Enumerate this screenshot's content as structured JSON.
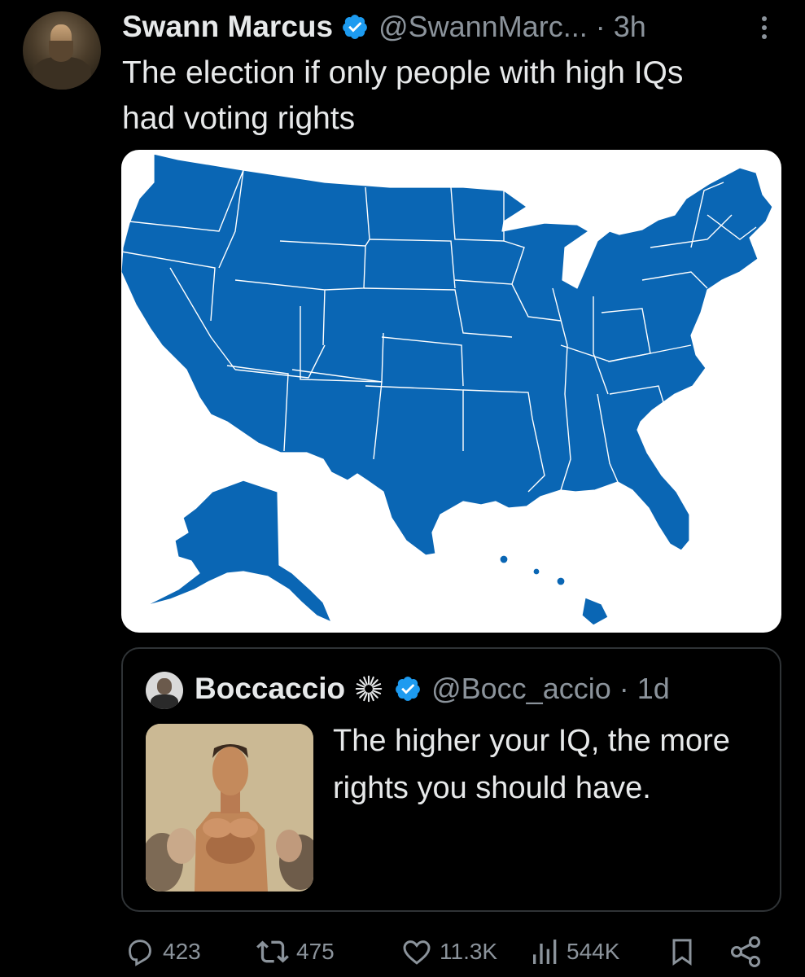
{
  "tweet": {
    "author_name": "Swann Marcus",
    "handle": "@SwannMarc...",
    "time": "· 3h",
    "text_line1": "The election if only people with high IQs",
    "text_line2": "had voting rights",
    "map_fill_color": "#0a66b4"
  },
  "quoted": {
    "author_name": "Boccaccio",
    "handle": "@Bocc_accio",
    "time": "· 1d",
    "text": "The higher your IQ, the more rights you should have."
  },
  "actions": {
    "replies": "423",
    "reposts": "475",
    "likes": "11.3K",
    "views": "544K"
  },
  "icons": [
    "verified-badge-icon",
    "more-options-icon",
    "reply-icon",
    "repost-icon",
    "like-icon",
    "views-icon",
    "bookmark-icon",
    "share-icon",
    "sunburst-badge-icon"
  ],
  "colors": {
    "background": "#000000",
    "text": "#e7e9ea",
    "secondary": "#8b939b",
    "verified": "#1d9bf0",
    "border": "#2f3336"
  }
}
